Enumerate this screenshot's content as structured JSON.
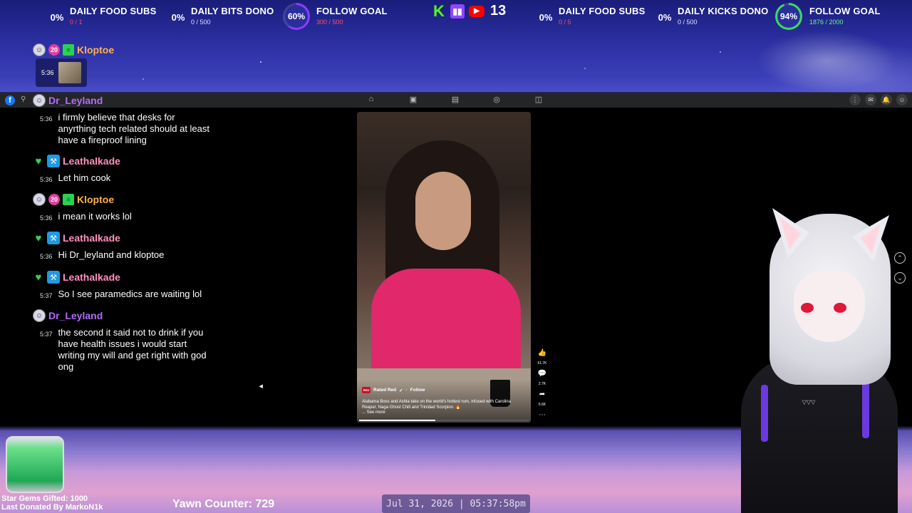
{
  "goals_left": [
    {
      "pct": "0%",
      "title": "DAILY FOOD SUBS",
      "sub": "0 / 1",
      "sub_color": "red"
    },
    {
      "pct": "0%",
      "title": "DAILY BITS DONO",
      "sub": "0 / 500",
      "sub_color": "white"
    },
    {
      "pct": "60%",
      "title": "FOLLOW GOAL",
      "sub": "300 / 500",
      "sub_color": "pinkred",
      "progress": 0.6
    }
  ],
  "goals_right": [
    {
      "pct": "0%",
      "title": "DAILY FOOD SUBS",
      "sub": "0 / 5",
      "sub_color": "red"
    },
    {
      "pct": "0%",
      "title": "DAILY KICKS DONO",
      "sub": "0 / 500",
      "sub_color": "white"
    },
    {
      "pct": "94%",
      "title": "FOLLOW GOAL",
      "sub": "1876 / 2000",
      "sub_color": "green",
      "progress": 0.94
    }
  ],
  "platforms": {
    "icons": [
      "kick-icon",
      "twitch-icon",
      "youtube-icon"
    ],
    "viewer_count": "13"
  },
  "chat": {
    "top_message": {
      "user": "Kloptoe",
      "badge_num": "20",
      "time": "5:36"
    },
    "header_user": "Dr_Leyland",
    "messages": [
      {
        "time": "5:36",
        "text": "i firmly believe that desks for anyrthing tech related should at least have a fireproof lining"
      },
      {
        "user": "Leathalkade",
        "time": "5:36",
        "text": "Let him cook"
      },
      {
        "user": "Kloptoe",
        "badge_num": "20",
        "time": "5:36",
        "text": "i mean it works lol"
      },
      {
        "user": "Leathalkade",
        "time": "5:36",
        "text": "Hi Dr_leyland and kloptoe"
      },
      {
        "user": "Leathalkade",
        "time": "5:37",
        "text": "So I see paramedics are waiting lol"
      },
      {
        "user": "Dr_Leyland",
        "time": "5:37",
        "text": "the second it said not to drink if you have health issues i would start writing my will and get right with god ong"
      }
    ]
  },
  "video": {
    "channel": "Rated Red",
    "follow": "Follow",
    "description": "Alabama Boss and Ashla take on the world's hottest rum, infused with Carolina Reaper, Naga Ghost Chili and Trinidad Scorpion. 🔥",
    "see_more": "... See more",
    "likes": "51.7K",
    "comments": "2.7K",
    "shares": "6.6K",
    "progress": 0.45
  },
  "bottom": {
    "gems_line1": "Star Gems Gifted: 1000",
    "gems_line2": "Last Donated By MarkoN1k",
    "yawn": "Yawn Counter: 729",
    "clock": "Jul 31, 2026 | 05:37:58pm"
  },
  "colors": {
    "kick": "#53fc18",
    "twitch": "#9146ff",
    "youtube": "#ff0000",
    "follow_ring_left": "#8a3cff",
    "follow_ring_right": "#3cd860"
  }
}
